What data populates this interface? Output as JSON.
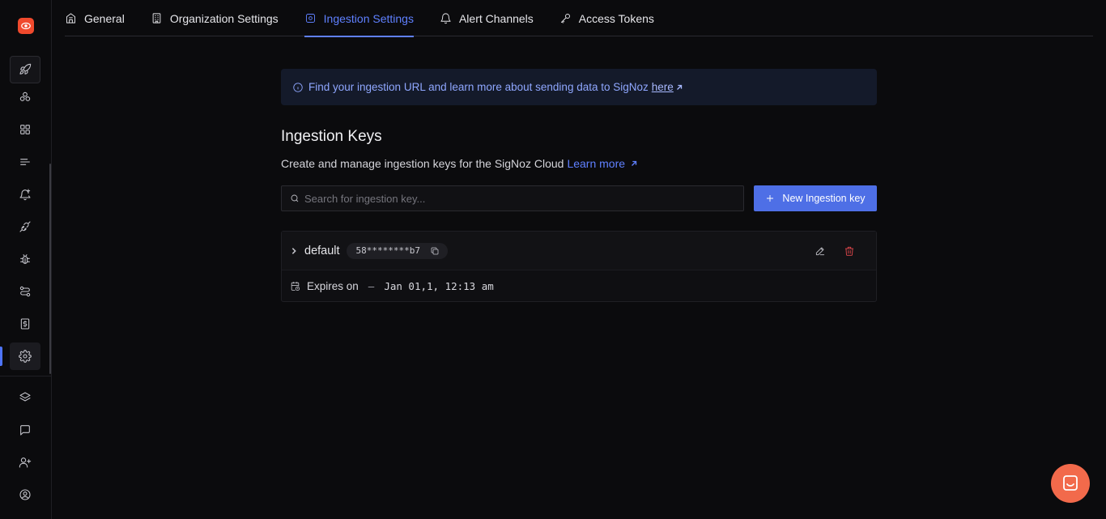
{
  "tabs": [
    {
      "label": "General",
      "icon": "building-icon",
      "active": false
    },
    {
      "label": "Organization Settings",
      "icon": "office-icon",
      "active": false
    },
    {
      "label": "Ingestion Settings",
      "icon": "settings-icon",
      "active": true
    },
    {
      "label": "Alert Channels",
      "icon": "bell-icon",
      "active": false
    },
    {
      "label": "Access Tokens",
      "icon": "key-icon",
      "active": false
    }
  ],
  "banner": {
    "text": "Find your ingestion URL and learn more about sending data to SigNoz",
    "link": "here"
  },
  "section": {
    "title": "Ingestion Keys",
    "subtitle": "Create and manage ingestion keys for the SigNoz Cloud",
    "learn_more": "Learn more"
  },
  "search": {
    "placeholder": "Search for ingestion key..."
  },
  "new_button": {
    "label": "New Ingestion key"
  },
  "key": {
    "name": "default",
    "masked_value": "58********b7",
    "expires_label": "Expires on",
    "expires_value": "Jan 01,1, 12:13 am"
  },
  "colors": {
    "accent": "#5f80ff",
    "primary_button": "#4e6fe6",
    "danger": "#e5484d",
    "brand": "#f04a2d",
    "chat": "#f26a4b"
  }
}
